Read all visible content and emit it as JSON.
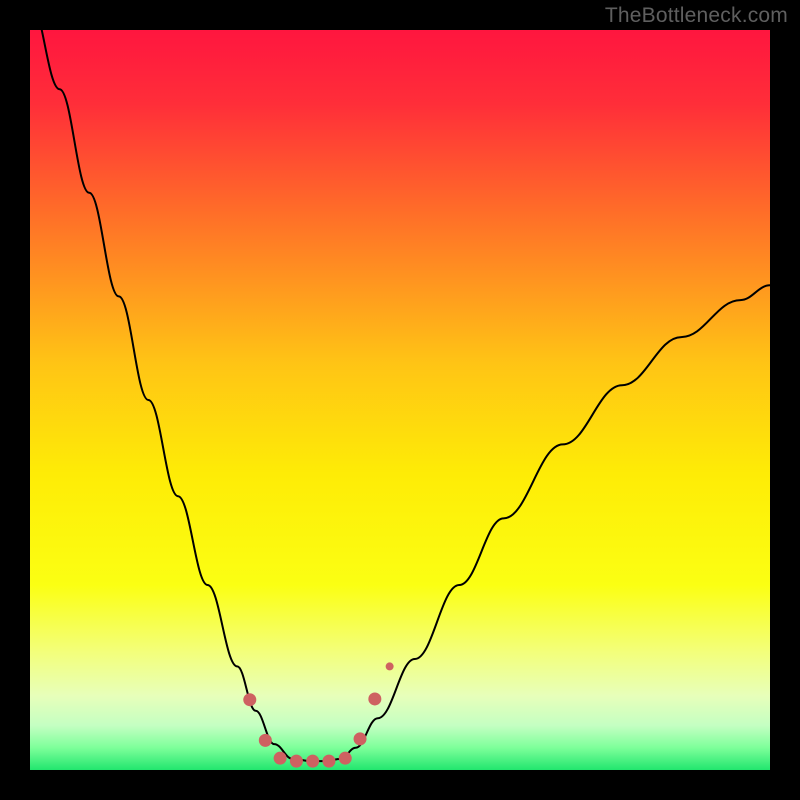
{
  "watermark": {
    "text": "TheBottleneck.com"
  },
  "chart_data": {
    "type": "line",
    "title": "",
    "xlabel": "",
    "ylabel": "",
    "xlim": [
      0,
      100
    ],
    "ylim": [
      0,
      100
    ],
    "grid": false,
    "legend": "none",
    "gradient_stops": [
      {
        "pct": 0,
        "color": "#ff163f"
      },
      {
        "pct": 10,
        "color": "#ff2e39"
      },
      {
        "pct": 25,
        "color": "#ff6f28"
      },
      {
        "pct": 45,
        "color": "#ffc415"
      },
      {
        "pct": 60,
        "color": "#feec06"
      },
      {
        "pct": 75,
        "color": "#fbff13"
      },
      {
        "pct": 84,
        "color": "#f3ff7a"
      },
      {
        "pct": 90,
        "color": "#e7ffba"
      },
      {
        "pct": 94,
        "color": "#c4ffc2"
      },
      {
        "pct": 97,
        "color": "#7dff9a"
      },
      {
        "pct": 100,
        "color": "#22e66e"
      }
    ],
    "series": [
      {
        "name": "bottleneck-curve",
        "x": [
          0,
          4,
          8,
          12,
          16,
          20,
          24,
          28,
          30.5,
          33,
          35.5,
          38,
          40,
          42,
          44,
          47,
          52,
          58,
          64,
          72,
          80,
          88,
          96,
          100
        ],
        "y": [
          104,
          92,
          78,
          64,
          50,
          37,
          25,
          14,
          8,
          3.5,
          1.5,
          1.2,
          1.2,
          1.5,
          3,
          7,
          15,
          25,
          34,
          44,
          52,
          58.5,
          63.5,
          65.5
        ],
        "stroke": "#000000",
        "stroke_width": 2
      }
    ],
    "markers": [
      {
        "x": 29.7,
        "y": 9.5,
        "r": 6.5,
        "color": "#ce6161"
      },
      {
        "x": 31.8,
        "y": 4.0,
        "r": 6.5,
        "color": "#ce6161"
      },
      {
        "x": 33.8,
        "y": 1.6,
        "r": 6.5,
        "color": "#ce6161"
      },
      {
        "x": 36.0,
        "y": 1.2,
        "r": 6.5,
        "color": "#ce6161"
      },
      {
        "x": 38.2,
        "y": 1.2,
        "r": 6.5,
        "color": "#ce6161"
      },
      {
        "x": 40.4,
        "y": 1.2,
        "r": 6.5,
        "color": "#ce6161"
      },
      {
        "x": 42.6,
        "y": 1.6,
        "r": 6.5,
        "color": "#ce6161"
      },
      {
        "x": 44.6,
        "y": 4.2,
        "r": 6.5,
        "color": "#ce6161"
      },
      {
        "x": 46.6,
        "y": 9.6,
        "r": 6.5,
        "color": "#ce6161"
      },
      {
        "x": 48.6,
        "y": 14.0,
        "r": 4.0,
        "color": "#ce6161"
      }
    ]
  }
}
